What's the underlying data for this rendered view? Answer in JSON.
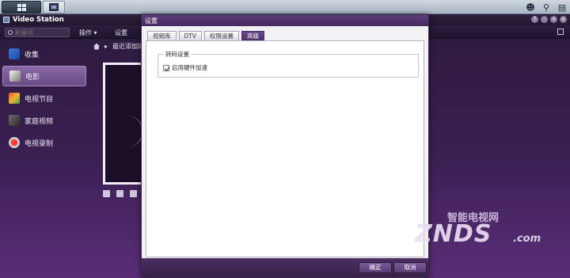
{
  "taskbar": {
    "main_menu_icon": "grid-icon",
    "app_icon": "film-icon",
    "user_icon": "user-icon",
    "search_icon": "search-icon",
    "widgets_icon": "widgets-icon"
  },
  "app": {
    "title": "Video Station",
    "window_controls": [
      "?",
      "-",
      "+",
      "x"
    ]
  },
  "toolbar": {
    "search_placeholder": "关键词",
    "ops_label": "操作 ▾",
    "settings_label": "设置"
  },
  "sidebar": {
    "items": [
      {
        "label": "收集",
        "icon": "favorites-icon"
      },
      {
        "label": "电影",
        "icon": "movie-icon",
        "active": true
      },
      {
        "label": "电视节目",
        "icon": "tv-icon"
      },
      {
        "label": "家庭视频",
        "icon": "home-video-icon"
      },
      {
        "label": "电视录制",
        "icon": "record-icon"
      }
    ]
  },
  "breadcrumb": {
    "item": "最近添加的"
  },
  "dialog": {
    "title": "设置",
    "tabs": [
      {
        "label": "视频库"
      },
      {
        "label": "DTV"
      },
      {
        "label": "权限设置"
      },
      {
        "label": "高级",
        "active": true
      }
    ],
    "section_title": "转码设置",
    "checkbox_label": "启用硬件加速",
    "checkbox_checked": true,
    "ok_label": "确定",
    "cancel_label": "取消"
  },
  "watermark": {
    "cn": "智能电视网",
    "brand": "ZNDS",
    "domain": ".com"
  }
}
